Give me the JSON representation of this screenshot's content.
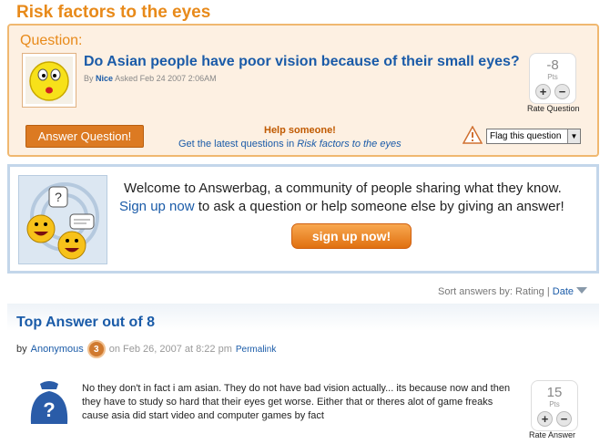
{
  "page": {
    "title": "Risk factors to the eyes"
  },
  "question": {
    "label": "Question:",
    "text": "Do Asian people have poor vision because of their small eyes?",
    "meta_prefix": "By",
    "author": "Nice",
    "asked": "Asked Feb 24 2007 2:06AM",
    "points": "-8",
    "points_unit": "Pts",
    "rate_label": "Rate Question",
    "answer_button": "Answer Question!",
    "help_title": "Help someone!",
    "help_sub_prefix": "Get the latest questions in",
    "help_sub_category": "Risk factors to the eyes",
    "flag_select": "Flag this question"
  },
  "welcome": {
    "line1": "Welcome to Answerbag, a community of people sharing what they know.",
    "signup_link": "Sign up now",
    "line2_rest": " to ask a question or help someone else by giving an answer!",
    "signup_button": "sign up now!"
  },
  "sort": {
    "label": "Sort answers by:",
    "rating": "Rating",
    "separator": "|",
    "date": "Date"
  },
  "top_answer": {
    "title": "Top Answer out of 8",
    "by": "by",
    "author": "Anonymous",
    "level": "3",
    "date": "on Feb 26, 2007 at 8:22 pm",
    "permalink": "Permalink",
    "text": "No they don't in fact i am asian. They do not have bad vision actually... its because now and then they have to study so hard that their eyes get worse. Either that or theres alot of game freaks cause asia did start video and computer games by fact",
    "points": "15",
    "points_unit": "Pts",
    "rate_label": "Rate Answer"
  },
  "icons": {
    "question_avatar": "smiley-face-icon",
    "warning": "warning-triangle-icon",
    "welcome": "community-smileys-icon",
    "answer": "anonymous-user-icon"
  },
  "colors": {
    "accent": "#e88a1a",
    "link": "#1a5ba8",
    "question_bg": "#fdf0e2",
    "welcome_border": "#c3d6ea"
  }
}
